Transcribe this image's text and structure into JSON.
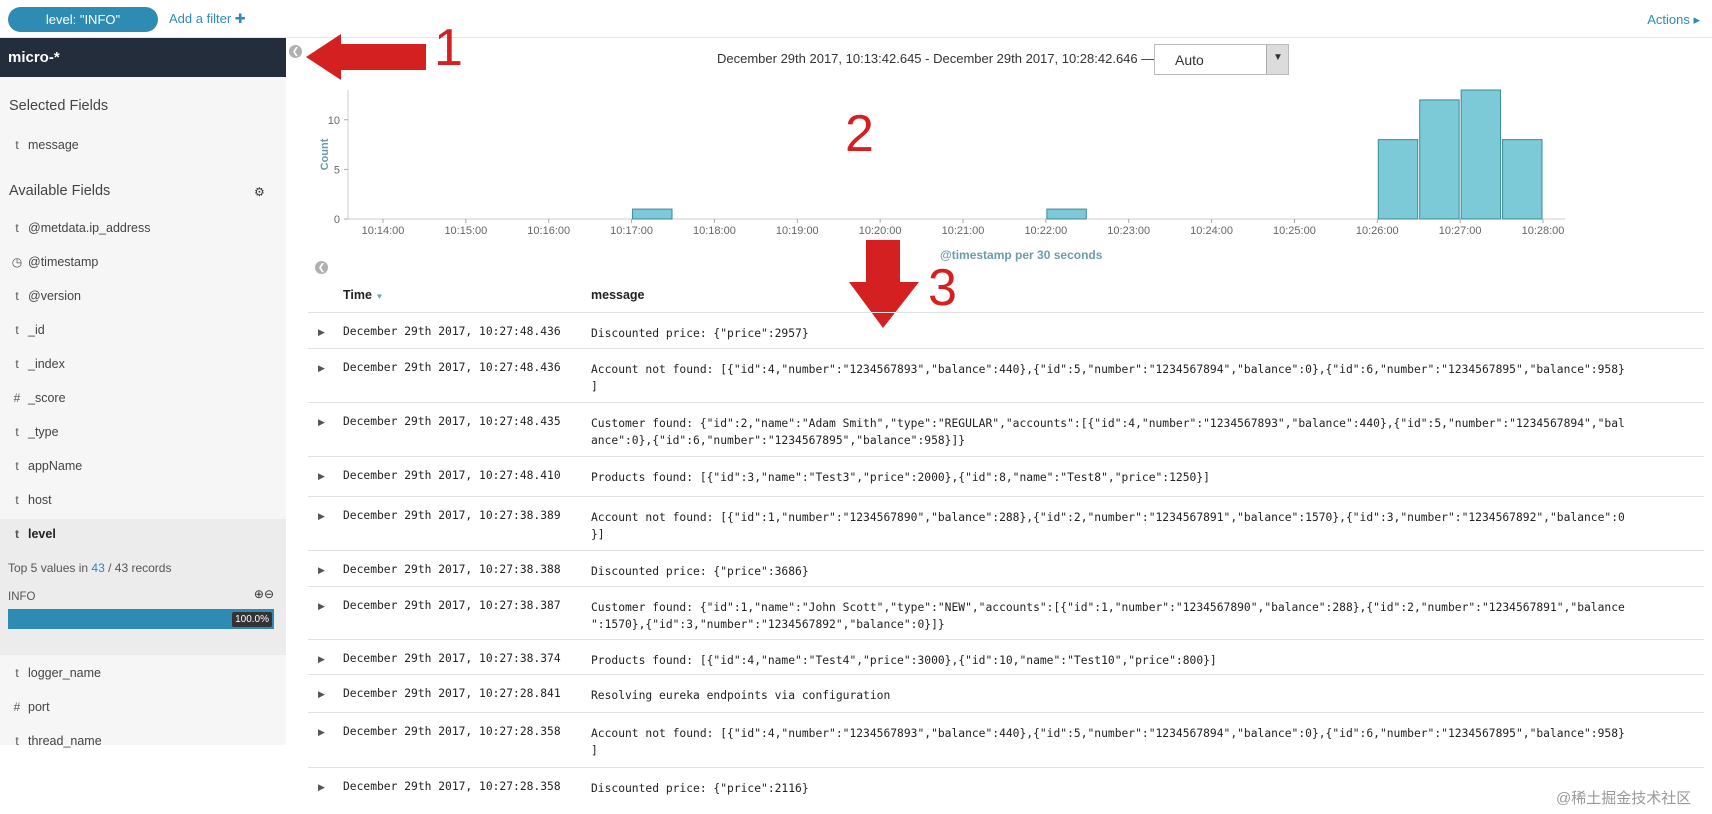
{
  "filterbar": {
    "filter_pill": "level: \"INFO\"",
    "add_filter": "Add a filter ✚",
    "actions": "Actions ▸"
  },
  "sidebar": {
    "index_pattern": "micro-*",
    "selected_title": "Selected Fields",
    "selected_fields": [
      {
        "type": "t",
        "name": "message"
      }
    ],
    "available_title": "Available Fields",
    "available_fields": [
      {
        "type": "t",
        "name": "@metdata.ip_address"
      },
      {
        "type": "◷",
        "name": "@timestamp"
      },
      {
        "type": "t",
        "name": "@version"
      },
      {
        "type": "t",
        "name": "_id"
      },
      {
        "type": "t",
        "name": "_index"
      },
      {
        "type": "#",
        "name": "_score"
      },
      {
        "type": "t",
        "name": "_type"
      },
      {
        "type": "t",
        "name": "appName"
      },
      {
        "type": "t",
        "name": "host"
      },
      {
        "type": "t",
        "name": "level"
      },
      {
        "type": "t",
        "name": "logger_name"
      },
      {
        "type": "#",
        "name": "port"
      },
      {
        "type": "t",
        "name": "thread_name"
      }
    ],
    "level_details": {
      "top_prefix": "Top 5 values in ",
      "count_found": "43",
      "sep": " / ",
      "count_total": "43",
      "suffix": " records",
      "value_label": "INFO",
      "percent_text": "100.0%",
      "percent": 100
    },
    "icons": {
      "gear": "gear-icon",
      "zoom_in": "zoom-in-icon",
      "zoom_out": "zoom-out-icon"
    }
  },
  "annotations": {
    "one": "1",
    "two": "2",
    "three": "3"
  },
  "timepicker": {
    "range": "December 29th 2017, 10:13:42.645 - December 29th 2017, 10:28:42.646 —",
    "interval": "Auto"
  },
  "chart_data": {
    "type": "bar",
    "ylabel": "Count",
    "xlabel": "@timestamp per 30 seconds",
    "ylim": [
      0,
      13
    ],
    "yticks": [
      0,
      5,
      10
    ],
    "xticks": [
      "10:14:00",
      "10:15:00",
      "10:16:00",
      "10:17:00",
      "10:18:00",
      "10:19:00",
      "10:20:00",
      "10:21:00",
      "10:22:00",
      "10:23:00",
      "10:24:00",
      "10:25:00",
      "10:26:00",
      "10:27:00",
      "10:28:00"
    ],
    "bars": [
      {
        "start": "10:17:00",
        "value": 1
      },
      {
        "start": "10:22:00",
        "value": 1
      },
      {
        "start": "10:26:00",
        "value": 8
      },
      {
        "start": "10:26:30",
        "value": 12
      },
      {
        "start": "10:27:00",
        "value": 13
      },
      {
        "start": "10:27:30",
        "value": 8
      }
    ],
    "color": "#7ccad8"
  },
  "table": {
    "col_time": "Time",
    "col_message": "message",
    "rows": [
      {
        "time": "December 29th 2017, 10:27:48.436",
        "message": "Discounted price: {\"price\":2957}"
      },
      {
        "time": "December 29th 2017, 10:27:48.436",
        "message": "Account not found: [{\"id\":4,\"number\":\"1234567893\",\"balance\":440},{\"id\":5,\"number\":\"1234567894\",\"balance\":0},{\"id\":6,\"number\":\"1234567895\",\"balance\":958}\n]"
      },
      {
        "time": "December 29th 2017, 10:27:48.435",
        "message": "Customer found: {\"id\":2,\"name\":\"Adam Smith\",\"type\":\"REGULAR\",\"accounts\":[{\"id\":4,\"number\":\"1234567893\",\"balance\":440},{\"id\":5,\"number\":\"1234567894\",\"bal\nance\":0},{\"id\":6,\"number\":\"1234567895\",\"balance\":958}]}"
      },
      {
        "time": "December 29th 2017, 10:27:48.410",
        "message": "Products found: [{\"id\":3,\"name\":\"Test3\",\"price\":2000},{\"id\":8,\"name\":\"Test8\",\"price\":1250}]"
      },
      {
        "time": "December 29th 2017, 10:27:38.389",
        "message": "Account not found: [{\"id\":1,\"number\":\"1234567890\",\"balance\":288},{\"id\":2,\"number\":\"1234567891\",\"balance\":1570},{\"id\":3,\"number\":\"1234567892\",\"balance\":0\n}]"
      },
      {
        "time": "December 29th 2017, 10:27:38.388",
        "message": "Discounted price: {\"price\":3686}"
      },
      {
        "time": "December 29th 2017, 10:27:38.387",
        "message": "Customer found: {\"id\":1,\"name\":\"John Scott\",\"type\":\"NEW\",\"accounts\":[{\"id\":1,\"number\":\"1234567890\",\"balance\":288},{\"id\":2,\"number\":\"1234567891\",\"balance\n\":1570},{\"id\":3,\"number\":\"1234567892\",\"balance\":0}]}"
      },
      {
        "time": "December 29th 2017, 10:27:38.374",
        "message": "Products found: [{\"id\":4,\"name\":\"Test4\",\"price\":3000},{\"id\":10,\"name\":\"Test10\",\"price\":800}]"
      },
      {
        "time": "December 29th 2017, 10:27:28.841",
        "message": "Resolving eureka endpoints via configuration"
      },
      {
        "time": "December 29th 2017, 10:27:28.358",
        "message": "Account not found: [{\"id\":4,\"number\":\"1234567893\",\"balance\":440},{\"id\":5,\"number\":\"1234567894\",\"balance\":0},{\"id\":6,\"number\":\"1234567895\",\"balance\":958}\n]"
      },
      {
        "time": "December 29th 2017, 10:27:28.358",
        "message": "Discounted price: {\"price\":2116}"
      }
    ]
  },
  "watermark": "@稀土掘金技术社区"
}
